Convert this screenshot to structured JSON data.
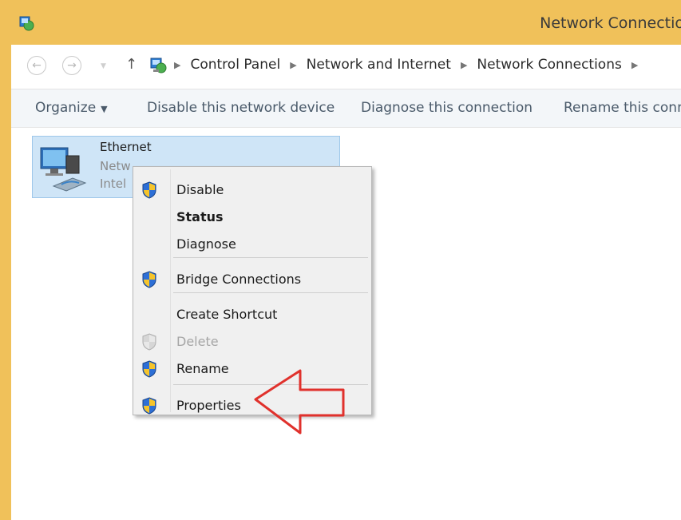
{
  "window": {
    "title": "Network Connectio"
  },
  "address": {
    "crumbs": [
      "Control Panel",
      "Network and Internet",
      "Network Connections"
    ]
  },
  "toolbar": {
    "organize": "Organize",
    "disable": "Disable this network device",
    "diagnose": "Diagnose this connection",
    "rename": "Rename this conn"
  },
  "connection": {
    "name": "Ethernet",
    "line1": "Netw",
    "line2": "Intel"
  },
  "menu": {
    "items": [
      {
        "label": "Disable",
        "shield": true,
        "bold": false,
        "disabled": false
      },
      {
        "label": "Status",
        "shield": false,
        "bold": true,
        "disabled": false
      },
      {
        "label": "Diagnose",
        "shield": false,
        "bold": false,
        "disabled": false
      },
      {
        "label": "Bridge Connections",
        "shield": true,
        "bold": false,
        "disabled": false
      },
      {
        "label": "Create Shortcut",
        "shield": false,
        "bold": false,
        "disabled": false
      },
      {
        "label": "Delete",
        "shield": true,
        "bold": false,
        "disabled": true
      },
      {
        "label": "Rename",
        "shield": true,
        "bold": false,
        "disabled": false
      },
      {
        "label": "Properties",
        "shield": true,
        "bold": false,
        "disabled": false
      }
    ]
  },
  "colors": {
    "titlebar": "#f0c15a",
    "selection": "#cfe5f7",
    "callout": "#e0312c"
  },
  "icons": {
    "back": "back-arrow-icon",
    "forward": "forward-arrow-icon",
    "up": "up-arrow-icon",
    "location": "control-panel-icon",
    "connection": "network-adapter-icon",
    "uac": "uac-shield-icon"
  }
}
